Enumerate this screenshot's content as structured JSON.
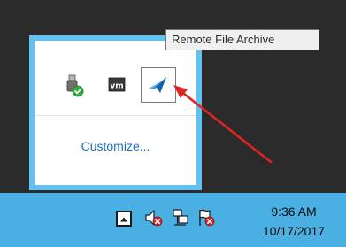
{
  "tooltip": {
    "text": "Remote File Archive"
  },
  "overflow_tray": {
    "icons": [
      {
        "name": "safely-remove-hardware-icon"
      },
      {
        "name": "vm-tools-icon",
        "label": "vm"
      },
      {
        "name": "remote-file-archive-icon"
      }
    ],
    "customize_label": "Customize..."
  },
  "annotation": {
    "arrow_color": "#e32222"
  },
  "taskbar": {
    "time": "9:36 AM",
    "date": "10/17/2017",
    "accent_color": "#4ab0e3"
  }
}
